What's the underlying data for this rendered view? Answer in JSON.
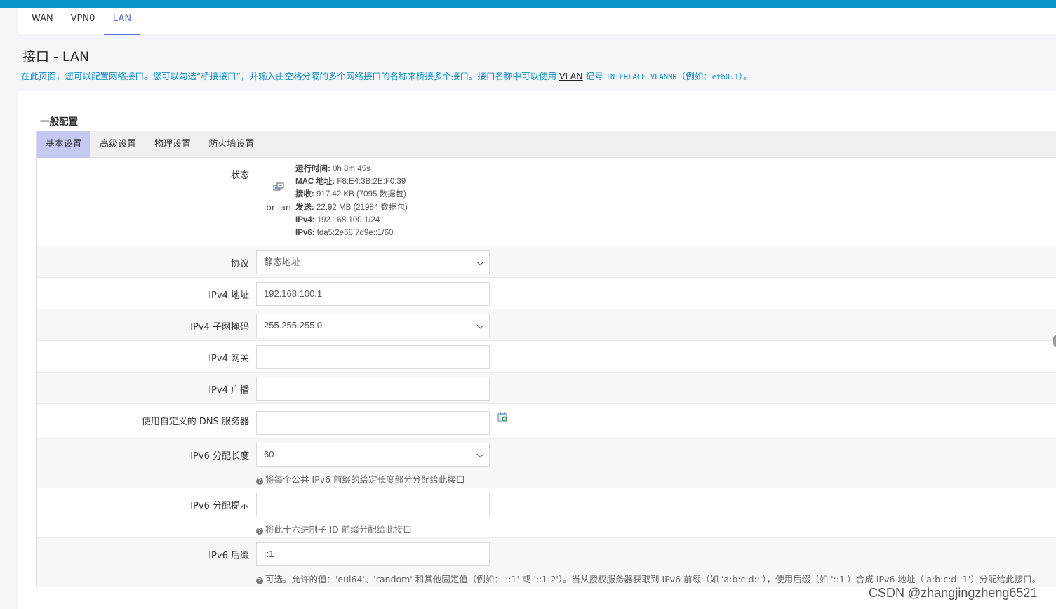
{
  "top_tabs": [
    {
      "label": "WAN"
    },
    {
      "label": "VPN0"
    },
    {
      "label": "LAN"
    }
  ],
  "page": {
    "title": "接口 - LAN",
    "desc_part1": "在此页面，您可以配置网络接口。您可以勾选“桥接接口”，并输入由空格分隔的多个网络接口的名称来桥接多个接口。接口名称中可以使用 ",
    "desc_vlan": "VLAN",
    "desc_part2": " 记号 ",
    "desc_code": "INTERFACE.VLANNR",
    "desc_part3": "（例如：",
    "desc_example": "eth0.1",
    "desc_part4": "）。"
  },
  "section": {
    "title": "一般配置"
  },
  "sub_tabs": [
    {
      "label": "基本设置"
    },
    {
      "label": "高级设置"
    },
    {
      "label": "物理设置"
    },
    {
      "label": "防火墙设置"
    }
  ],
  "status": {
    "label": "状态",
    "icon": "network-bridge-icon",
    "interface": "br-lan",
    "uptime_key": "运行时间:",
    "uptime_val": " 0h 8m 45s",
    "mac_key": "MAC 地址:",
    "mac_val": " F8:E4:3B:2E:F0:39",
    "rx_key": "接收:",
    "rx_val": " 917.42 KB (7095 数据包)",
    "tx_key": "发送:",
    "tx_val": " 22.92 MB (21984 数据包)",
    "ipv4_key": "IPv4:",
    "ipv4_val": " 192.168.100.1/24",
    "ipv6_key": "IPv6:",
    "ipv6_val": " fda5:2e68:7d9e::1/60"
  },
  "fields": {
    "protocol": {
      "label": "协议",
      "value": "静态地址"
    },
    "ipv4_addr": {
      "label": "IPv4 地址",
      "value": "192.168.100.1"
    },
    "ipv4_mask": {
      "label": "IPv4 子网掩码",
      "value": "255.255.255.0"
    },
    "ipv4_gw": {
      "label": "IPv4 网关",
      "value": ""
    },
    "ipv4_bcast": {
      "label": "IPv4 广播",
      "value": ""
    },
    "dns": {
      "label": "使用自定义的 DNS 服务器",
      "value": "",
      "add_icon": "add-entry-icon"
    },
    "ipv6_assign_len": {
      "label": "IPv6 分配长度",
      "value": "60",
      "hint": "将每个公共 IPv6 前缀的给定长度部分分配给此接口"
    },
    "ipv6_hint": {
      "label": "IPv6 分配提示",
      "value": "",
      "hint": "将此十六进制子 ID 前缀分配给此接口"
    },
    "ipv6_suffix": {
      "label": "IPv6 后缀",
      "value": "::1",
      "hint": "可选。允许的值：'eui64'、'random' 和其他固定值（例如：'::1' 或 '::1:2'）。当从授权服务器获取到 IPv6 前缀（如 'a:b:c:d::'），使用后缀（如 '::1'）合成 IPv6 地址（'a:b:c:d::1'）分配给此接口。"
    }
  },
  "watermark": "CSDN @zhangjingzheng6521",
  "colors": {
    "accent": "#0a96c8",
    "tab_active": "#5b6fd6",
    "subtab_active": "#c5c9f2"
  }
}
